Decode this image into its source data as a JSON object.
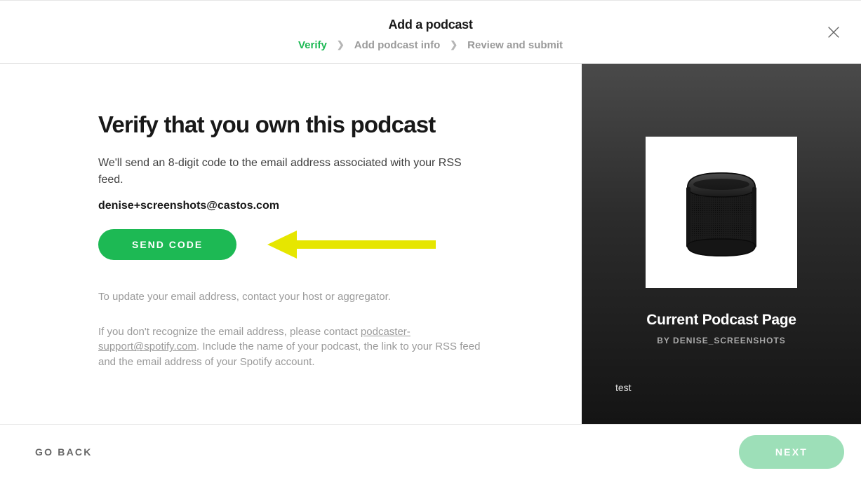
{
  "header": {
    "title": "Add a podcast",
    "steps": {
      "verify": "Verify",
      "add_info": "Add podcast info",
      "review": "Review and submit"
    }
  },
  "main": {
    "heading": "Verify that you own this podcast",
    "description": "We'll send an 8-digit code to the email address associated with your RSS feed.",
    "email": "denise+screenshots@castos.com",
    "send_code_label": "SEND CODE",
    "update_hint": "To update your email address, contact your host or aggregator.",
    "support_prefix": "If you don't recognize the email address, please contact ",
    "support_link": "podcaster-support@spotify.com",
    "support_suffix": ". Include the name of your podcast, the link to your RSS feed and the email address of your Spotify account."
  },
  "preview": {
    "title": "Current Podcast Page",
    "byline": "BY DENISE_SCREENSHOTS",
    "description": "test"
  },
  "footer": {
    "go_back": "GO BACK",
    "next": "NEXT"
  },
  "colors": {
    "accent": "#1db954",
    "arrow": "#e6e600"
  }
}
